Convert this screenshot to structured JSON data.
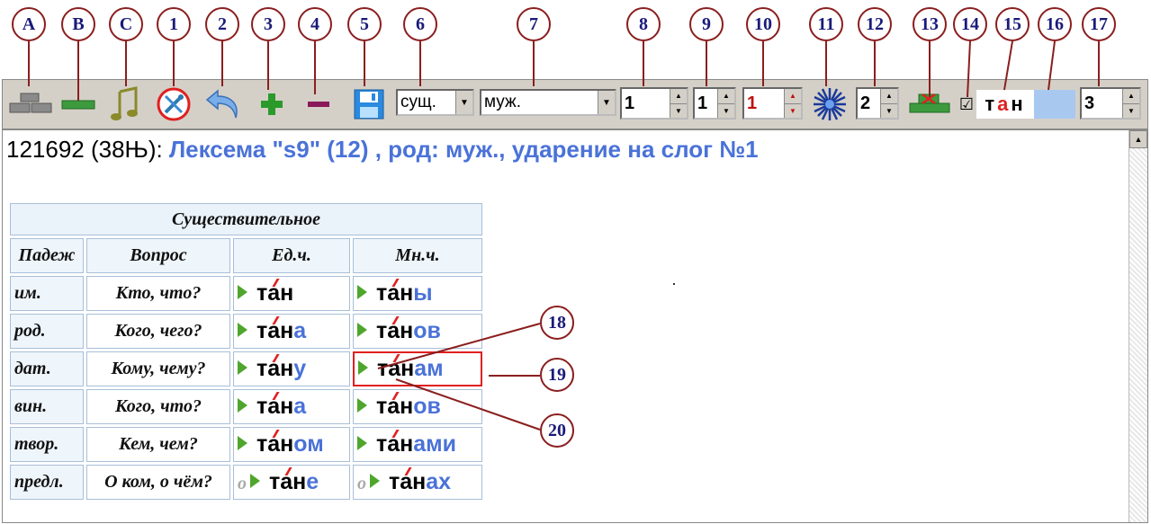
{
  "callouts": {
    "labels": [
      "A",
      "B",
      "C",
      "1",
      "2",
      "3",
      "4",
      "5",
      "6",
      "7",
      "8",
      "9",
      "10",
      "11",
      "12",
      "13",
      "14",
      "15",
      "16",
      "17"
    ],
    "side": [
      "18",
      "19",
      "20"
    ]
  },
  "toolbar": {
    "icons": [
      "bricks-icon",
      "single-brick-icon",
      "music-note-icon",
      "tools-icon",
      "undo-arrow-icon",
      "plus-icon",
      "minus-icon",
      "floppy-disk-icon"
    ],
    "pos_select": "сущ.",
    "gender_select": "муж.",
    "spin8": "1",
    "spin9": "1",
    "spin10": "1",
    "star_icon": "star-burst-icon",
    "spin12": "2",
    "crossed_brick_icon": "crossed-brick-icon",
    "checkbox_checked": true,
    "checkbox_mark": "☑",
    "stem_preview": {
      "t": "т",
      "a": "а",
      "n": "н"
    },
    "color_swatch": "#a8c8f0",
    "spin17": "3"
  },
  "header": {
    "id_text": "121692 (38Њ): ",
    "desc_text": "Лексема \"s9\" (12) , род: муж., ударение на слог №1"
  },
  "table": {
    "title": "Существительное",
    "headers": [
      "Падеж",
      "Вопрос",
      "Ед.ч.",
      "Мн.ч."
    ],
    "rows": [
      {
        "case": "им.",
        "question": "Кто, что?",
        "sg": {
          "stem": "тан",
          "end": ""
        },
        "pl": {
          "stem": "тан",
          "end": "ы"
        }
      },
      {
        "case": "род.",
        "question": "Кого, чего?",
        "sg": {
          "stem": "тан",
          "end": "а"
        },
        "pl": {
          "stem": "тан",
          "end": "ов"
        }
      },
      {
        "case": "дат.",
        "question": "Кому, чему?",
        "sg": {
          "stem": "тан",
          "end": "у"
        },
        "pl": {
          "stem": "тан",
          "end": "ам"
        }
      },
      {
        "case": "вин.",
        "question": "Кого, что?",
        "sg": {
          "stem": "тан",
          "end": "а"
        },
        "pl": {
          "stem": "тан",
          "end": "ов"
        }
      },
      {
        "case": "твор.",
        "question": "Кем, чем?",
        "sg": {
          "stem": "тан",
          "end": "ом"
        },
        "pl": {
          "stem": "тан",
          "end": "ами"
        }
      },
      {
        "case": "предл.",
        "question": "О ком, о чём?",
        "sg": {
          "stem": "тан",
          "end": "е",
          "prefix": "о"
        },
        "pl": {
          "stem": "тан",
          "end": "ах",
          "prefix": "о"
        }
      }
    ]
  },
  "colors": {
    "accent_blue": "#4a72d8",
    "stress_red": "#e02020",
    "play_green": "#4ea62c",
    "callout_border": "#8b1e1e",
    "callout_text": "#1a1a7a"
  }
}
